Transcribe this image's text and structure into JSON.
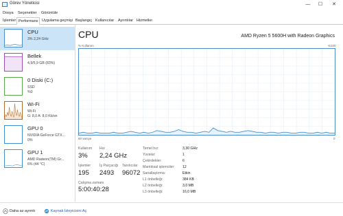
{
  "window": {
    "title": "Görev Yöneticisi",
    "minimize": "—",
    "maximize": "☐",
    "close": "✕"
  },
  "menu": [
    "Dosya",
    "Seçenekler",
    "Görüntüle"
  ],
  "tabs": [
    "İşlemler",
    "Performans",
    "Uygulama geçmişi",
    "Başlangıç",
    "Kullanıcılar",
    "Ayrıntılar",
    "Hizmetler"
  ],
  "active_tab": "Performans",
  "sidebar": [
    {
      "name": "CPU",
      "lines": [
        "3%  2,24 GHz"
      ]
    },
    {
      "name": "Bellek",
      "lines": [
        "4,9/5,9 GB (83%)"
      ]
    },
    {
      "name": "0 Diski (C:)",
      "lines": [
        "SSD",
        "%0"
      ]
    },
    {
      "name": "Wi-Fi",
      "lines": [
        "Wi-Fi",
        "G: 8,0  A: 8,0 Kb/sn"
      ]
    },
    {
      "name": "GPU 0",
      "lines": [
        "NVIDIA GeForce GTX...",
        "0%"
      ]
    },
    {
      "name": "GPU 1",
      "lines": [
        "AMD Radeon(TM) Gr...",
        "6% (44 °C)"
      ]
    }
  ],
  "main": {
    "title": "CPU",
    "model": "AMD Ryzen 5 5600H with Radeon Graphics",
    "graph_label_left": "% Kullanım",
    "graph_label_right": "%100",
    "graph_time": "60 saniye",
    "graph_zero": "0"
  },
  "stats": {
    "usage_label": "Kullanım",
    "usage_value": "3%",
    "speed_label": "Hız",
    "speed_value": "2,24 GHz",
    "processes_label": "İşlemler",
    "processes_value": "195",
    "threads_label": "İş Parçacığı",
    "threads_value": "2493",
    "handles_label": "Tanıtıcılar",
    "handles_value": "96072",
    "uptime_label": "Çalışma zamanı",
    "uptime_value": "5:00:40:28"
  },
  "details": [
    {
      "label": "Temel hız:",
      "value": "3,30 GHz"
    },
    {
      "label": "Yuvalar:",
      "value": "1"
    },
    {
      "label": "Çekirdekler:",
      "value": "6"
    },
    {
      "label": "Mantıksal işlemciler:",
      "value": "12"
    },
    {
      "label": "Sanallaştırma:",
      "value": "Etkin"
    },
    {
      "label": "L1 önbelleği:",
      "value": "384 KB"
    },
    {
      "label": "L2 önbelleği:",
      "value": "3,0 MB"
    },
    {
      "label": "L3 önbelleği:",
      "value": "16,0 MB"
    }
  ],
  "footer": {
    "less_details": "Daha az ayrıntı",
    "resource_monitor": "Kaynak İzleyicisini Aç"
  },
  "colors": {
    "graph_line": "#4a8ec9",
    "graph_fill": "#e8f2fa",
    "selected": "#cce4f7",
    "link": "#1f5fb8"
  },
  "graph_series": [
    2,
    3,
    2,
    2,
    3,
    2,
    2,
    2,
    3,
    2,
    2,
    3,
    4,
    3,
    2,
    3,
    2,
    3,
    5,
    4,
    3,
    3,
    4,
    6,
    4,
    3,
    3,
    2,
    3,
    4,
    3,
    8,
    5,
    4,
    3,
    4,
    3,
    3,
    4,
    5,
    4,
    3,
    3,
    2,
    3,
    3,
    2,
    3,
    3,
    2,
    2,
    3,
    3,
    2,
    2,
    3,
    2,
    3,
    2,
    2
  ],
  "wifi_series": [
    2,
    5,
    3,
    8,
    4,
    14,
    6,
    3,
    9,
    5,
    2,
    18,
    7,
    4,
    11,
    5,
    3,
    8,
    4,
    2
  ]
}
